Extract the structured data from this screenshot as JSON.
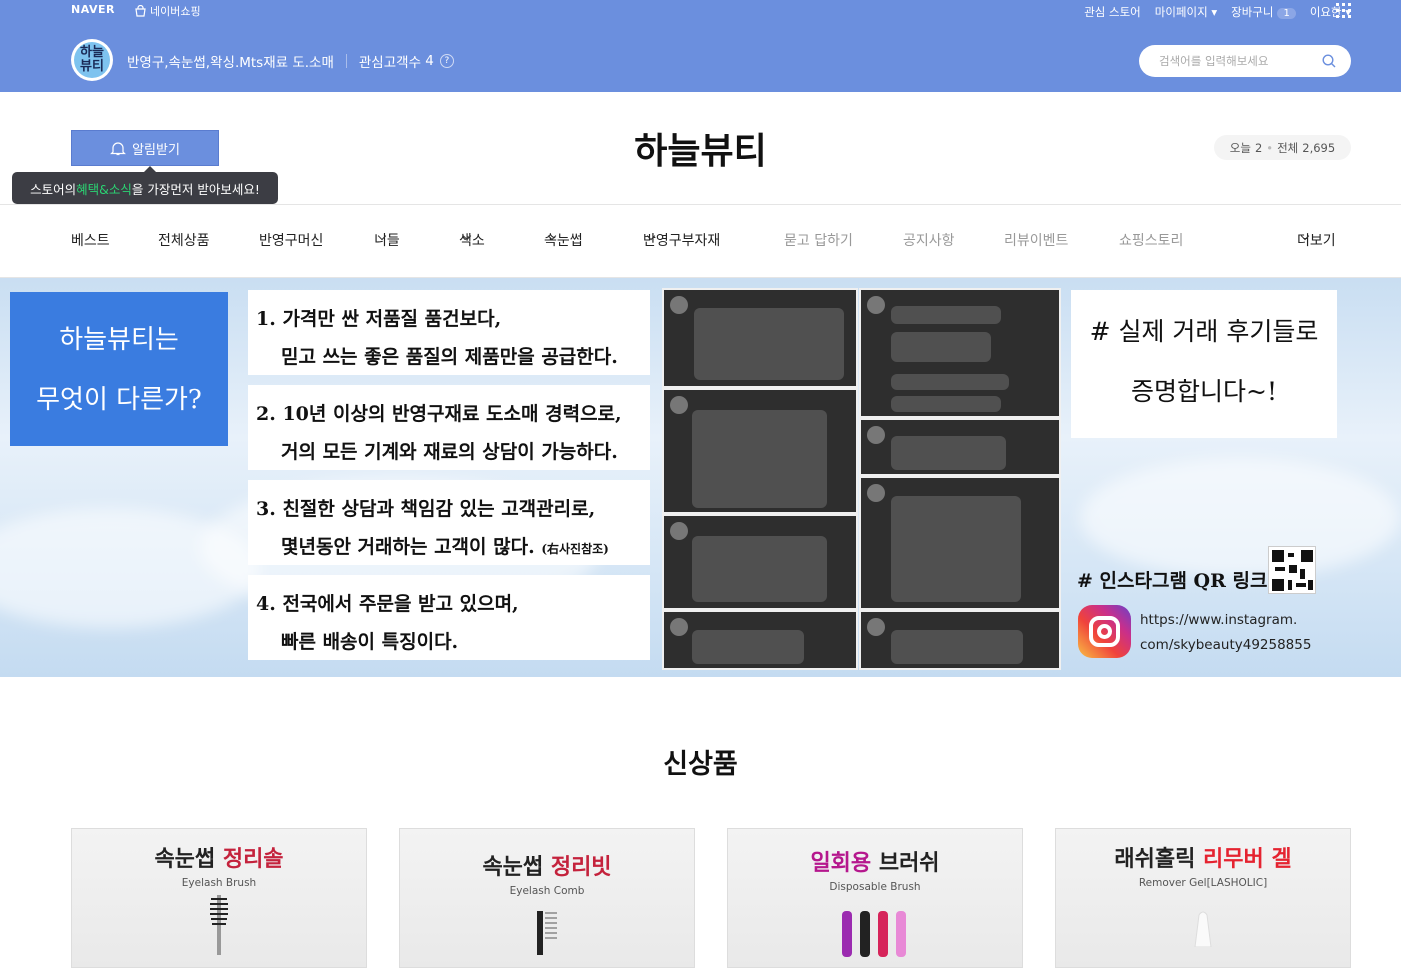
{
  "topbar": {
    "naver": "NAVER",
    "naver_shopping": "네이버쇼핑",
    "links": {
      "favorite_store": "관심 스토어",
      "mypage": "마이페이지",
      "cart": "장바구니",
      "cart_count": "1",
      "user": "이요한"
    }
  },
  "header": {
    "logo_text_1": "하늘",
    "logo_text_2": "뷰티",
    "store_desc": "반영구,속눈썹,왁싱.Mts재료 도.소매",
    "followers_label": "관심고객수",
    "followers_count": "4",
    "help_glyph": "?",
    "search_placeholder": "검색어를 입력해보세요"
  },
  "title_area": {
    "notify_button": "알림받기",
    "tooltip_prefix": "스토어의 ",
    "tooltip_highlight": "혜택&소식",
    "tooltip_suffix": "을 가장먼저 받아보세요!",
    "store_name": "하늘뷰티",
    "today_label": "오늘",
    "today_count": "2",
    "total_label": "전체",
    "total_count": "2,695"
  },
  "nav": {
    "items": [
      {
        "label": "베스트"
      },
      {
        "label": "전체상품"
      },
      {
        "label": "반영구머신"
      },
      {
        "label": "니들"
      },
      {
        "label": "색소"
      },
      {
        "label": "속눈썹"
      },
      {
        "label": "반영구부자재"
      },
      {
        "label": "묻고 답하기"
      },
      {
        "label": "공지사항"
      },
      {
        "label": "리뷰이벤트"
      },
      {
        "label": "쇼핑스토리"
      },
      {
        "label": "더보기"
      }
    ]
  },
  "banner": {
    "intro_line1": "하늘뷰티는",
    "intro_line2": "무엇이 다른가?",
    "points": [
      {
        "line1": "1. 가격만 싼 저품질 품건보다,",
        "line2": "믿고 쓰는 좋은 품질의 제품만을 공급한다."
      },
      {
        "line1": "2. 10년 이상의 반영구재료 도소매 경력으로,",
        "line2": "거의 모든 기계와 재료의 상담이 가능하다."
      },
      {
        "line1": "3. 친절한 상담과 책임감 있는 고객관리로,",
        "line2": "몇년동안 거래하는 고객이 많다.",
        "note": "(右사진참조)"
      },
      {
        "line1": "4. 전국에서 주문을 받고 있으며,",
        "line2": "빠른 배송이 특징이다."
      }
    ],
    "proof_line1": "# 실제 거래 후기들로",
    "proof_line2": "증명합니다~!",
    "insta_title": "# 인스타그램 QR 링크",
    "insta_url_1": "https://www.instagram.",
    "insta_url_2": "com/skybeauty49258855"
  },
  "new_products": {
    "title": "신상품",
    "cards": [
      {
        "title_a": "속눈썹 ",
        "title_b": "정리솔",
        "sub": "Eyelash Brush",
        "accent": "#c4223c"
      },
      {
        "title_a": "속눈썹 ",
        "title_b": "정리빗",
        "sub": "Eyelash Comb",
        "accent": "#c4223c"
      },
      {
        "title_a": "일회용 ",
        "title_b": "브러쉬",
        "sub": "Disposable Brush",
        "accent": "#b5178d"
      },
      {
        "title_a": "래쉬홀릭 ",
        "title_b": "리무버 겔",
        "sub": "Remover Gel[LASHOLIC]",
        "accent": "#e52330"
      }
    ]
  },
  "colors": {
    "brand_blue": "#6b8fde",
    "tooltip_bg": "#3c3d44",
    "tooltip_highlight": "#2bd473"
  }
}
